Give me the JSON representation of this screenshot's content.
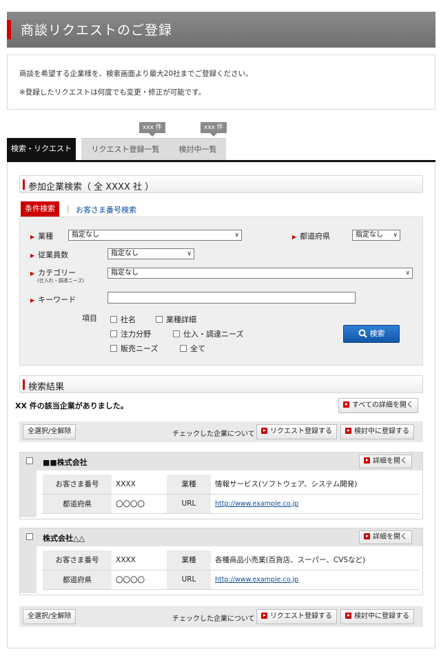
{
  "header": {
    "title": "商談リクエストのご登録"
  },
  "intro": {
    "line1": "商談を希望する企業様を、検索画面より最大20社までご登録ください。",
    "line2": "※登録したリクエストは何度でも変更・修正が可能です。"
  },
  "tabs": {
    "items": [
      {
        "label": "検索・リクエスト"
      },
      {
        "label": "リクエスト登録一覧",
        "badge": "xxx 件"
      },
      {
        "label": "検討中一覧",
        "badge": "xxx 件"
      }
    ]
  },
  "search_section": {
    "title": "参加企業検索（ 全 XXXX 社 ）",
    "subtab_active": "条件検索",
    "subtab_sep": "|",
    "subtab_link": "お客さま番号検索",
    "fields": {
      "industry": {
        "label": "業種",
        "value": "指定なし"
      },
      "prefecture": {
        "label": "都道府県",
        "value": "指定なし"
      },
      "employees": {
        "label": "従業員数",
        "value": "指定なし"
      },
      "category": {
        "label": "カテゴリー",
        "sublabel": "(仕入れ・調達ニーズ)",
        "value": "指定なし"
      },
      "keyword": {
        "label": "キーワード",
        "value": ""
      }
    },
    "items_label": "項目",
    "checkboxes": [
      "社名",
      "業種詳細",
      "注力分野",
      "仕入・調達ニーズ",
      "販売ニーズ",
      "全て"
    ],
    "search_button": "検索"
  },
  "results": {
    "title": "検索結果",
    "count_text": "XX 件の該当企業がありました。",
    "open_all": "すべての詳細を開く",
    "select_all": "全選択/全解除",
    "checked_note": "チェックした企業について",
    "request_btn": "リクエスト登録する",
    "consider_btn": "検討中に登録する",
    "detail_btn": "詳細を開く",
    "companies": [
      {
        "name": "■■株式会社",
        "customer_no_label": "お客さま番号",
        "customer_no": "XXXX",
        "industry_label": "業種",
        "industry": "情報サービス(ソフトウェア、システム開発)",
        "pref_label": "都道府県",
        "pref": "〇〇〇〇",
        "url_label": "URL",
        "url": "http://www.example.co.jp"
      },
      {
        "name": "株式会社△△",
        "customer_no_label": "お客さま番号",
        "customer_no": "XXXX",
        "industry_label": "業種",
        "industry": "各種商品小売業(百貨店、スーパー、CVSなど)",
        "pref_label": "都道府県",
        "pref": "〇〇〇〇",
        "url_label": "URL",
        "url": "http://www.example.co.jp"
      }
    ]
  },
  "colors": {
    "accent": "#cc0000",
    "header_bg": "#7d7d7d",
    "button_blue": "#1c64bd",
    "link": "#0b4a9b"
  }
}
